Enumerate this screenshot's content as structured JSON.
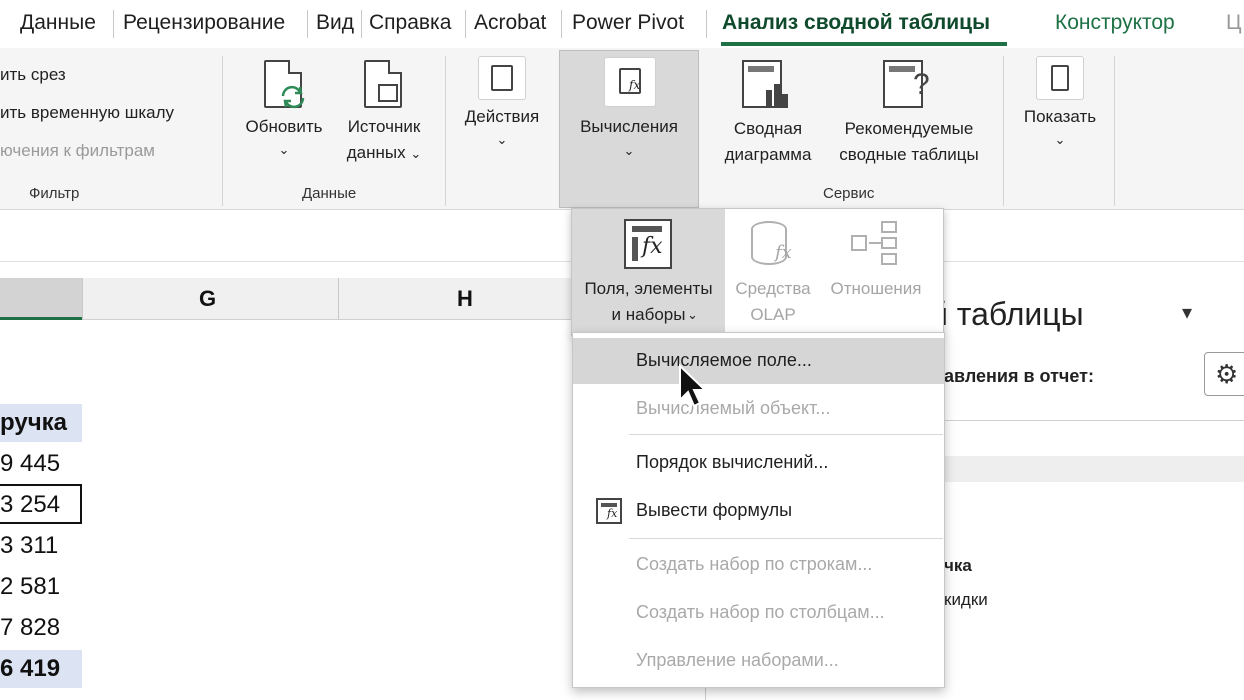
{
  "tabs": {
    "items": [
      {
        "label": "Данные"
      },
      {
        "label": "Рецензирование"
      },
      {
        "label": "Вид"
      },
      {
        "label": "Справка"
      },
      {
        "label": "Acrobat"
      },
      {
        "label": "Power Pivot"
      },
      {
        "label": "Анализ сводной таблицы"
      },
      {
        "label": "Конструктор"
      },
      {
        "label": "Ц"
      }
    ]
  },
  "ribbon": {
    "filter": {
      "slicer": "ить срез",
      "timeline": "ить временную шкалу",
      "connections": "ючения к фильтрам",
      "label": "Фильтр"
    },
    "data": {
      "refresh_line1": "Обновить",
      "source_line1": "Источник",
      "source_line2": "данных",
      "label": "Данные"
    },
    "actions": {
      "label": "Действия"
    },
    "calculations": {
      "label": "Вычисления"
    },
    "tools": {
      "pivotchart_line1": "Сводная",
      "pivotchart_line2": "диаграмма",
      "recommended_line1": "Рекомендуемые",
      "recommended_line2": "сводные таблицы",
      "label": "Сервис"
    },
    "show": {
      "label": "Показать"
    }
  },
  "calc_dropdown": {
    "fields_line1": "Поля, элементы",
    "fields_line2": "и наборы",
    "olap_line1": "Средства",
    "olap_line2": "OLAP",
    "relations": "Отношения"
  },
  "menu": {
    "items": [
      {
        "label": "Вычисляемое поле..."
      },
      {
        "label": "Вычисляемый объект..."
      },
      {
        "label": "Порядок вычислений..."
      },
      {
        "label": "Вывести формулы"
      },
      {
        "label": "Создать набор по строкам..."
      },
      {
        "label": "Создать набор по столбцам..."
      },
      {
        "label": "Управление наборами..."
      }
    ]
  },
  "sheet": {
    "columns": [
      {
        "label": "G"
      },
      {
        "label": "H"
      }
    ],
    "header": "ручка",
    "values": [
      "9 445",
      "3 254",
      "3 311",
      "2 581",
      "7 828",
      "6 419"
    ]
  },
  "pane": {
    "title": "й таблицы",
    "subtitle": "авления в отчет:",
    "field1": "чка",
    "field2": "кидки"
  },
  "colors": {
    "accent": "#1e7145",
    "ribbon_bg": "#f5f5f5",
    "pivot_header": "#dce3f3",
    "hover": "#d6d6d6"
  }
}
